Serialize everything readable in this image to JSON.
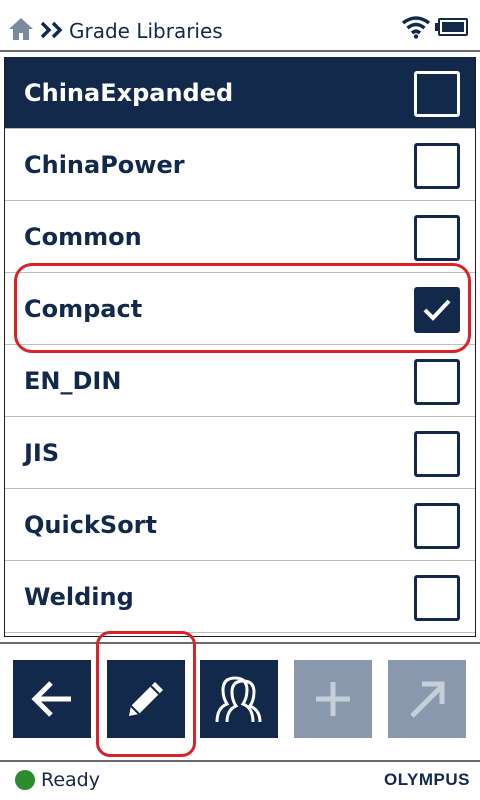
{
  "header": {
    "title": "Grade Libraries",
    "home_icon": "home-icon",
    "breadcrumb_icon": "double-chevron-right-icon",
    "wifi_icon": "wifi-icon",
    "battery_icon": "battery-icon"
  },
  "libraries": [
    {
      "label": "ChinaExpanded",
      "checked": false,
      "selected": true
    },
    {
      "label": "ChinaPower",
      "checked": false,
      "selected": false
    },
    {
      "label": "Common",
      "checked": false,
      "selected": false
    },
    {
      "label": "Compact",
      "checked": true,
      "selected": false
    },
    {
      "label": "EN_DIN",
      "checked": false,
      "selected": false
    },
    {
      "label": "JIS",
      "checked": false,
      "selected": false
    },
    {
      "label": "QuickSort",
      "checked": false,
      "selected": false
    },
    {
      "label": "Welding",
      "checked": false,
      "selected": false
    }
  ],
  "toolbar": {
    "back_icon": "arrow-left-icon",
    "edit_icon": "pencil-icon",
    "user_icon": "user-profile-icon",
    "add_icon": "plus-icon",
    "add_enabled": false,
    "export_icon": "arrow-up-right-icon",
    "export_enabled": false
  },
  "status": {
    "text": "Ready",
    "color": "#2e8b2e"
  },
  "brand": "OLYMPUS",
  "colors": {
    "primary": "#13294b",
    "disabled": "#8a98ad",
    "highlight": "#d9222a"
  }
}
